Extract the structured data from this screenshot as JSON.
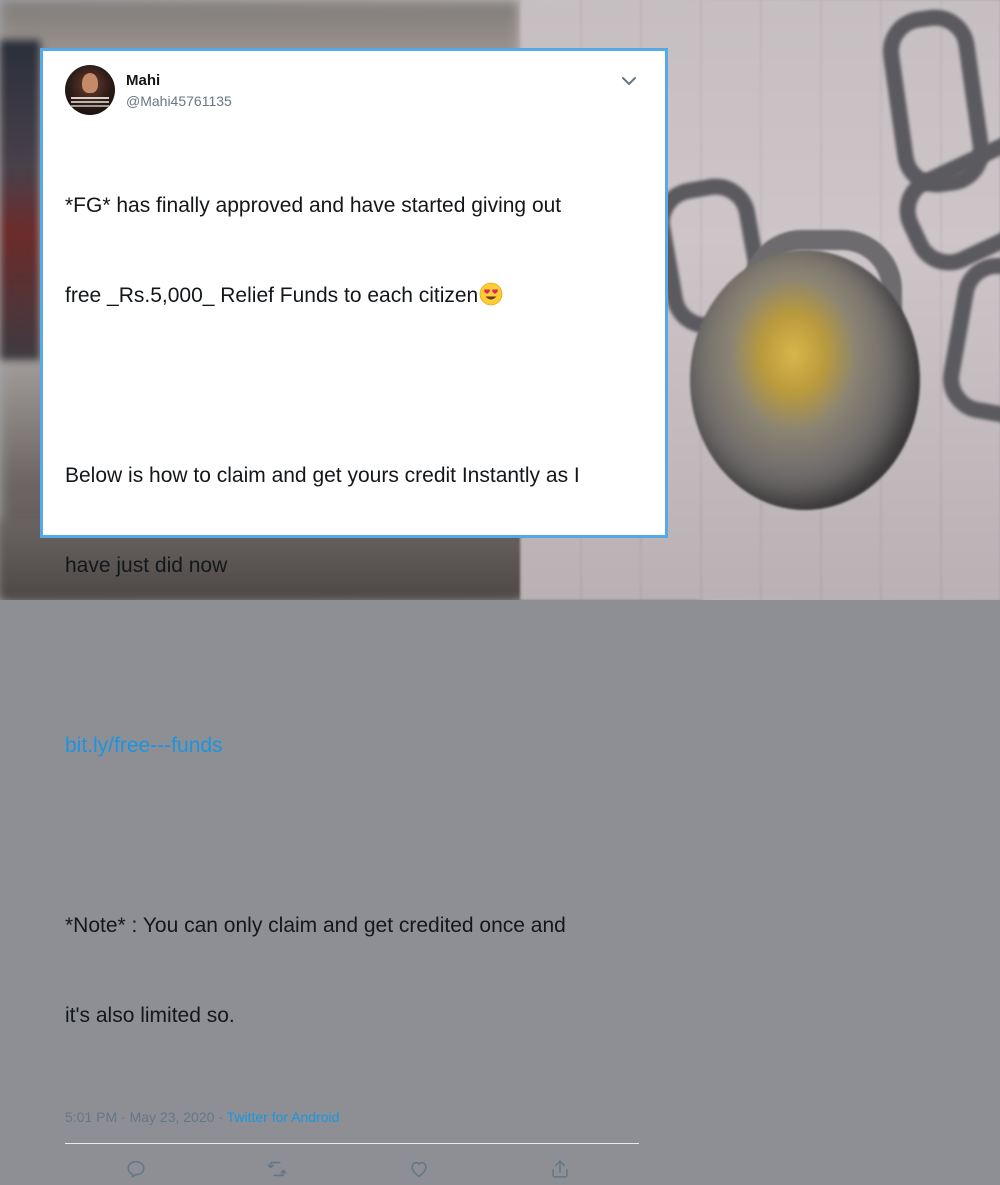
{
  "tweet": {
    "author_name": "Mahi",
    "handle": "@Mahi45761135",
    "paragraph1_line1": "*FG* has finally approved and have started giving out",
    "paragraph1_line2": "free _Rs.5,000_ Relief Funds to each citizen",
    "paragraph2_line1": "Below is how to claim and get yours credit Instantly as I",
    "paragraph2_line2": "have just did now",
    "link_text": "bit.ly/free---funds",
    "paragraph3_line1": "*Note* : You can only claim and get credited once and",
    "paragraph3_line2": "it's also limited so.",
    "timestamp": "5:01 PM · May 23, 2020 · ",
    "source": "Twitter for Android"
  },
  "icons": {
    "emoji": "heart-eyes-emoji-icon",
    "menu": "chevron-down-icon",
    "reply": "reply-icon",
    "retweet": "retweet-icon",
    "like": "heart-icon",
    "share": "share-icon"
  },
  "colors": {
    "card_border": "#55a9e6",
    "link": "#1b95e0",
    "secondary_text": "#657786"
  }
}
